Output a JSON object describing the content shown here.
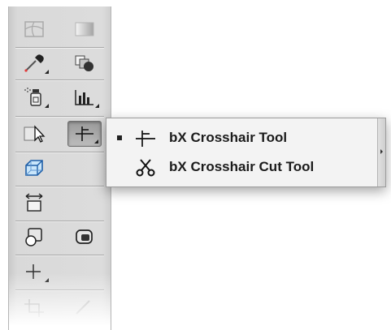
{
  "flyout": {
    "items": [
      {
        "label": "bX Crosshair Tool",
        "selected": true,
        "icon": "crosshair-icon"
      },
      {
        "label": "bX Crosshair Cut Tool",
        "selected": false,
        "icon": "scissors-icon"
      }
    ]
  },
  "toolbar": {
    "tools": [
      "mesh-icon",
      "gradient-icon",
      "eyedropper-icon",
      "blend-icon",
      "symbol-sprayer-icon",
      "column-graph-icon",
      "artboard-select-icon",
      "crosshair-icon",
      "3d-box-icon",
      "width-tool-icon",
      "shape-builder-icon",
      "rounded-rect-icon",
      "plus-icon",
      "crop-icon",
      "knife-icon"
    ],
    "active_tool": "crosshair-icon"
  },
  "colors": {
    "toolbar_bg": "#d9d9d9",
    "menu_bg": "#f3f3f3",
    "accent_blue": "#2f6fb3"
  }
}
